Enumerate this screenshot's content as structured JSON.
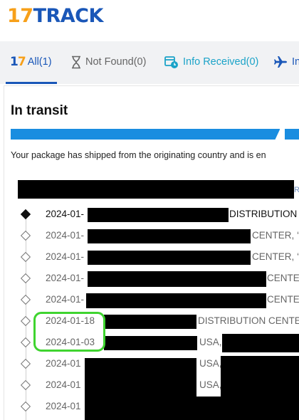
{
  "header": {
    "logo_num": "17",
    "logo_word": "TRACK"
  },
  "tabs": {
    "all": {
      "mark": "17",
      "label": "All(1)"
    },
    "not_found": {
      "label": "Not Found(0)"
    },
    "info_received": {
      "label": "Info Received(0)"
    },
    "in_transit": {
      "label": "In"
    }
  },
  "status": {
    "title": "In transit",
    "description": "Your package has shipped from the originating country and is en"
  },
  "events": [
    {
      "date": "2024-01-",
      "text": "DISTRIBUTION"
    },
    {
      "date": "2024-01-",
      "text": "CENTER, ‘"
    },
    {
      "date": "2024-01-",
      "text": "CENTER, ‘"
    },
    {
      "date": "2024-01-",
      "text": "CENTE"
    },
    {
      "date": "2024-01-",
      "text": "CENTE"
    },
    {
      "date": "2024-01-18",
      "text": "DISTRIBUTION CENTE"
    },
    {
      "date": "2024-01-03",
      "text": "USA,"
    },
    {
      "date": "2024-01",
      "text": "USA,"
    },
    {
      "date": "2024-01",
      "text": "USA,"
    },
    {
      "date": "2024-01",
      "text": ""
    }
  ],
  "colors": {
    "brand_blue": "#1a57b8",
    "brand_orange": "#f7a01a",
    "progress": "#1a8de0",
    "highlight": "#3fd42f"
  }
}
